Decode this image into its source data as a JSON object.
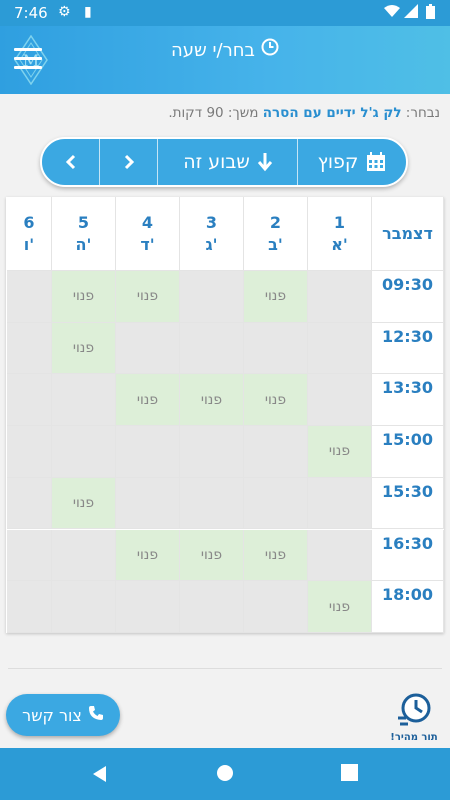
{
  "status": {
    "time": "7:46"
  },
  "header": {
    "title": "בחר/י שעה"
  },
  "selected": {
    "prefix": "נבחר:",
    "service": "לק ג'ל ידיים עם הסרה",
    "duration": "משך: 90 דקות."
  },
  "nav": {
    "jump": "קפוץ",
    "this_week": "שבוע זה",
    "next": "›",
    "prev": "‹"
  },
  "table": {
    "month": "דצמבר",
    "days": [
      {
        "num": "1",
        "name": "א'"
      },
      {
        "num": "2",
        "name": "ב'"
      },
      {
        "num": "3",
        "name": "ג'"
      },
      {
        "num": "4",
        "name": "ד'"
      },
      {
        "num": "5",
        "name": "ה'"
      },
      {
        "num": "6",
        "name": "ו'"
      }
    ],
    "times": [
      "09:30",
      "12:30",
      "13:30",
      "15:00",
      "15:30",
      "16:30",
      "18:00"
    ],
    "free_label": "פנוי",
    "slots": [
      [
        false,
        true,
        false,
        true,
        true,
        false
      ],
      [
        false,
        false,
        false,
        false,
        true,
        false
      ],
      [
        false,
        true,
        true,
        true,
        false,
        false
      ],
      [
        true,
        false,
        false,
        false,
        false,
        false
      ],
      [
        false,
        false,
        false,
        false,
        true,
        false
      ],
      [
        false,
        true,
        true,
        true,
        false,
        false
      ],
      [
        true,
        false,
        false,
        false,
        false,
        false
      ]
    ]
  },
  "footer": {
    "contact": "צור קשר",
    "quick": "תור מהיר!"
  },
  "colors": {
    "primary": "#3ba8e2",
    "free": "#ddefd8",
    "busy": "#e7e7e7"
  }
}
